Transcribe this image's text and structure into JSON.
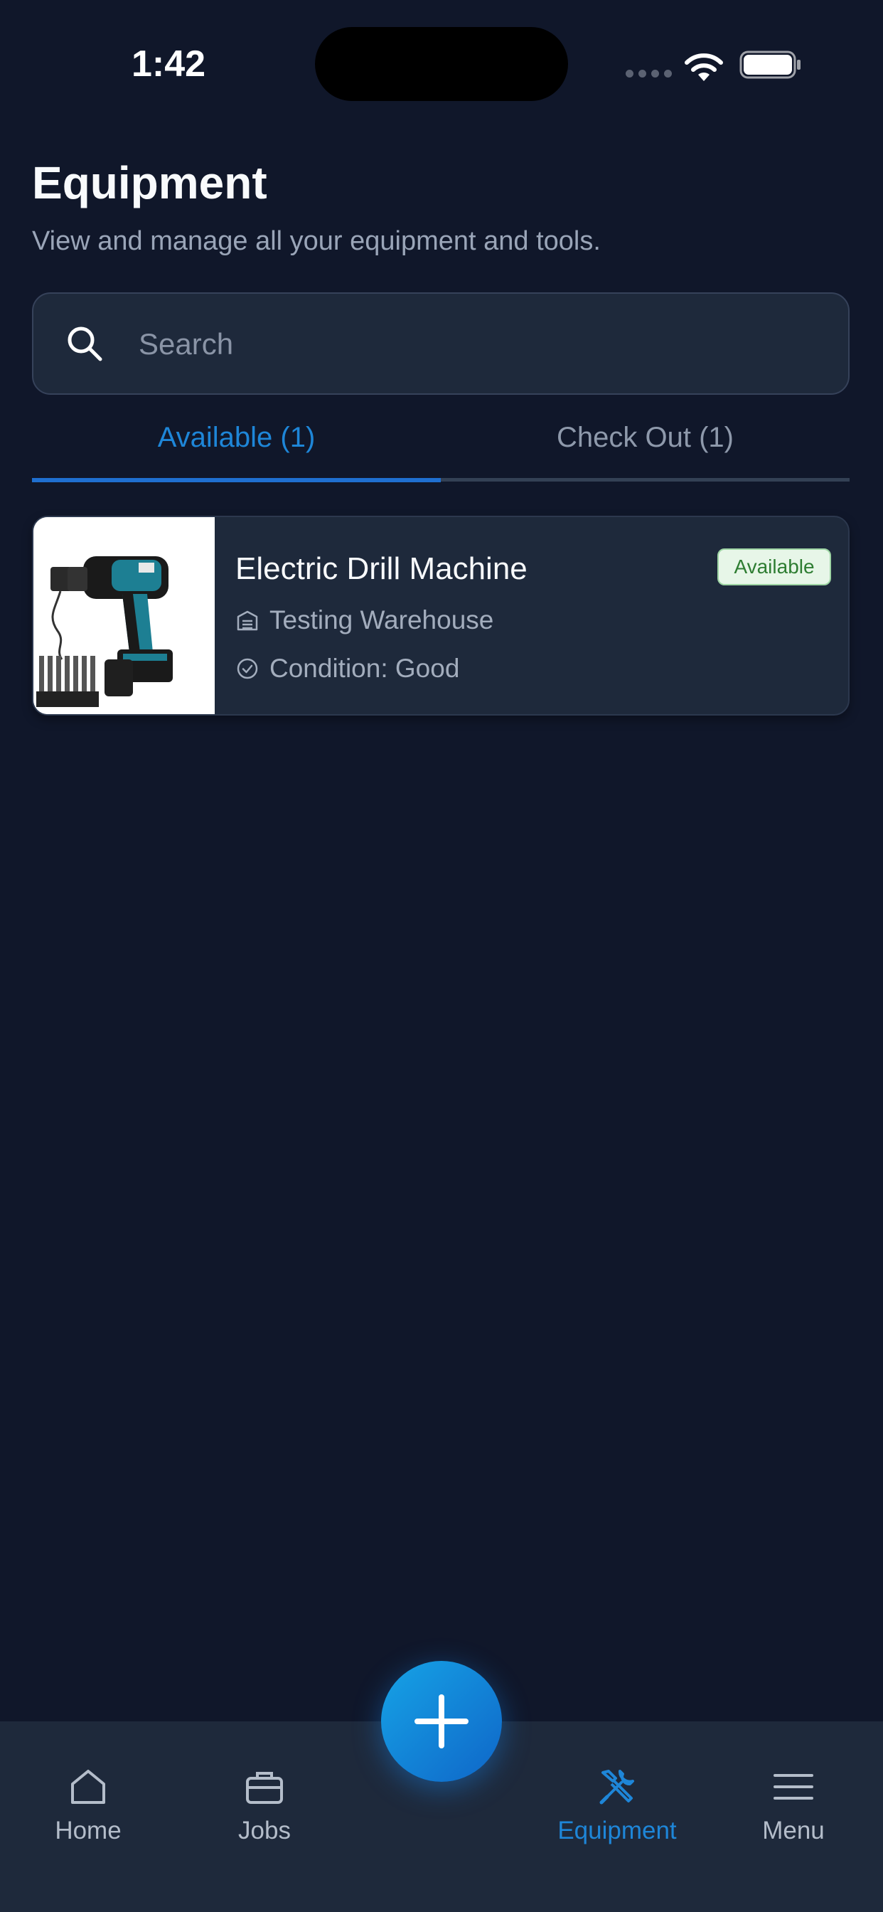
{
  "status_bar": {
    "time": "1:42"
  },
  "header": {
    "title": "Equipment",
    "subtitle": "View and manage all your equipment and tools."
  },
  "search": {
    "placeholder": "Search",
    "value": ""
  },
  "tabs": [
    {
      "label": "Available (1)",
      "active": true
    },
    {
      "label": "Check Out (1)",
      "active": false
    }
  ],
  "equipment_list": [
    {
      "name": "Electric Drill Machine",
      "status": "Available",
      "location": "Testing Warehouse",
      "condition": "Condition: Good",
      "thumbnail": "drill-kit-photo"
    }
  ],
  "bottom_nav": {
    "items": [
      {
        "label": "Home",
        "icon": "home-icon",
        "active": false
      },
      {
        "label": "Jobs",
        "icon": "briefcase-icon",
        "active": false
      },
      {
        "label": "Equipment",
        "icon": "tools-icon",
        "active": true
      },
      {
        "label": "Menu",
        "icon": "hamburger-menu-icon",
        "active": false
      }
    ],
    "fab_icon": "plus-icon"
  },
  "colors": {
    "background": "#10172a",
    "surface": "#1e293b",
    "accent": "#1e86d8",
    "badge_text": "#2e7d32",
    "badge_bg": "#e7f6e8"
  }
}
